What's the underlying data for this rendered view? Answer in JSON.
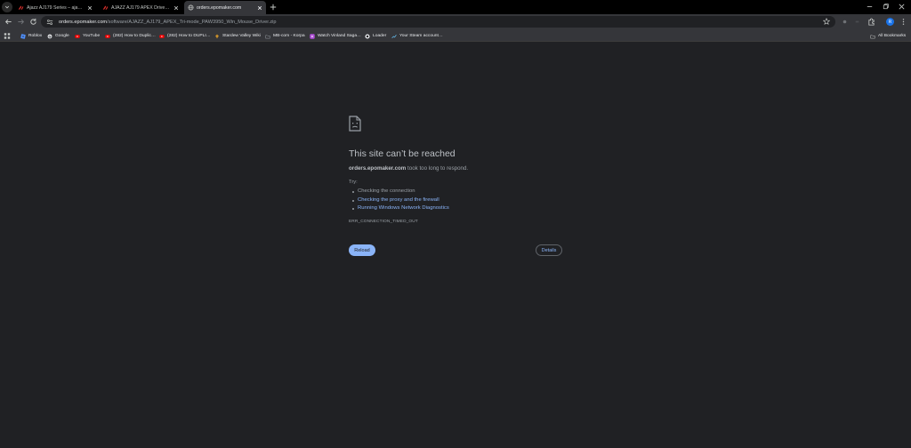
{
  "tabs": [
    {
      "title": "Ajazz AJ179 Series – ajazz keyb…",
      "favicon": "ajazz-logo-icon",
      "active": false
    },
    {
      "title": "AJAZZ AJ179 APEX Driver – aja…",
      "favicon": "ajazz-logo-icon",
      "active": false
    },
    {
      "title": "orders.epomaker.com",
      "favicon": "globe-icon",
      "active": true
    }
  ],
  "address_bar": {
    "host": "orders.epomaker.com",
    "path": "/software/AJAZZ_AJ179_APEX_Tri-mode_PAW3950_Win_Mouse_Driver.zip"
  },
  "profile_initial": "R",
  "bookmarks": [
    {
      "label": "Roblox",
      "icon": "roblox-icon",
      "color": "#4f8ef7"
    },
    {
      "label": "Google",
      "icon": "google-icon",
      "color": "#e8eaed"
    },
    {
      "label": "YouTube",
      "icon": "youtube-icon",
      "color": "#ff0000"
    },
    {
      "label": "(282) How to Duplic…",
      "icon": "youtube-icon",
      "color": "#ff0000"
    },
    {
      "label": "(282) How to DUPLI…",
      "icon": "youtube-icon",
      "color": "#ff0000"
    },
    {
      "label": "Stardew Valley Wiki",
      "icon": "stardew-icon",
      "color": "#e0a030"
    },
    {
      "label": "MB-com - Korpa",
      "icon": "folder-icon",
      "color": "#9aa0a6"
    },
    {
      "label": "Watch Vinland Saga…",
      "icon": "play-icon",
      "color": "#b04fd8"
    },
    {
      "label": "Loader",
      "icon": "loader-icon",
      "color": "#e8eaed"
    },
    {
      "label": "Your Steam account…",
      "icon": "steam-icon",
      "color": "#66c0f4"
    }
  ],
  "all_bookmarks_label": "All Bookmarks",
  "error": {
    "title": "This site can’t be reached",
    "host": "orders.epomaker.com",
    "message_suffix": " took too long to respond.",
    "try_label": "Try:",
    "suggestions": [
      {
        "text": "Checking the connection",
        "link": false
      },
      {
        "text": "Checking the proxy and the firewall",
        "link": true
      },
      {
        "text": "Running Windows Network Diagnostics",
        "link": true
      }
    ],
    "code": "ERR_CONNECTION_TIMED_OUT",
    "reload_label": "Reload",
    "details_label": "Details"
  },
  "colors": {
    "background": "#202124",
    "toolbar": "#35363a",
    "link": "#8ab4f8"
  }
}
